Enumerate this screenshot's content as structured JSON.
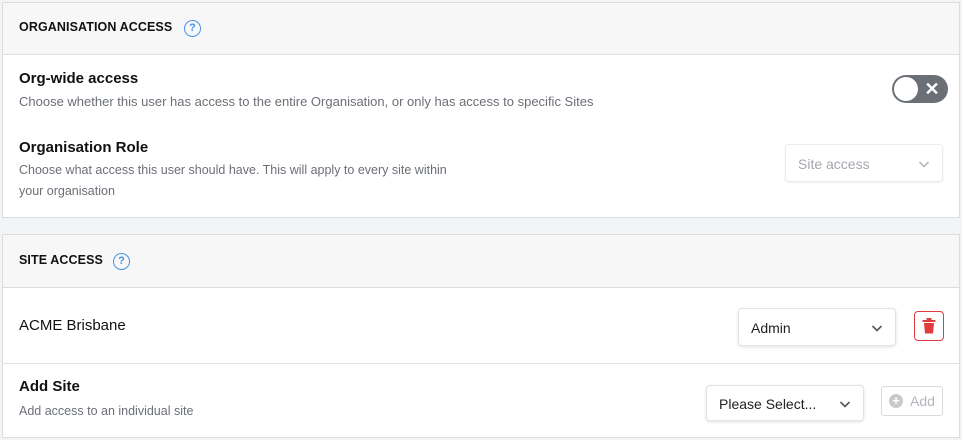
{
  "org_access": {
    "title": "ORGANISATION ACCESS",
    "help_icon": "?",
    "org_wide": {
      "title": "Org-wide access",
      "description": "Choose whether this user has access to the entire Organisation, or only has access to specific Sites",
      "toggle_on": false
    },
    "role": {
      "title": "Organisation Role",
      "description_line1": "Choose what access this user should have. This will apply to every site within",
      "description_line2": "your organisation",
      "select_value": "Site access"
    }
  },
  "site_access": {
    "title": "SITE ACCESS",
    "help_icon": "?",
    "sites": [
      {
        "name": "ACME Brisbane",
        "role": "Admin"
      }
    ],
    "add_site": {
      "title": "Add Site",
      "description": "Add access to an individual site",
      "select_placeholder": "Please Select...",
      "add_label": "Add"
    }
  },
  "colors": {
    "accent": "#4a90e2",
    "danger": "#e23b3b",
    "toggle_off": "#6b6f76"
  }
}
